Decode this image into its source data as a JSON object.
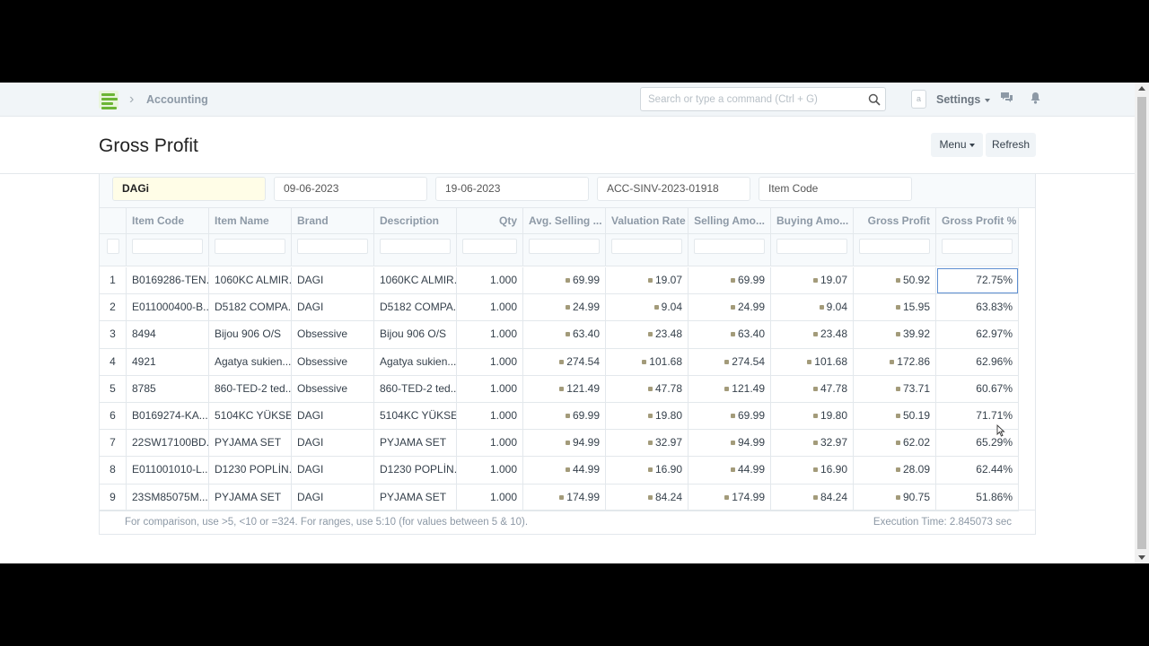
{
  "navbar": {
    "breadcrumb": "Accounting",
    "search_placeholder": "Search or type a command (Ctrl + G)",
    "avatar_letter": "a",
    "settings_label": "Settings"
  },
  "page": {
    "title": "Gross Profit",
    "menu_label": "Menu",
    "refresh_label": "Refresh"
  },
  "filters": [
    "DAGi",
    "09-06-2023",
    "19-06-2023",
    "ACC-SINV-2023-01918",
    "Item Code"
  ],
  "table": {
    "columns": [
      "Item Code",
      "Item Name",
      "Brand",
      "Description",
      "Qty",
      "Avg. Selling ...",
      "Valuation Rate",
      "Selling Amo...",
      "Buying Amo...",
      "Gross Profit",
      "Gross Profit %"
    ],
    "rows": [
      [
        "1",
        "B0169286-TEN...",
        "1060KC ALMIR...",
        "DAGI",
        "1060KC ALMIR...",
        "1.000",
        "69.99",
        "19.07",
        "69.99",
        "19.07",
        "50.92",
        "72.75%"
      ],
      [
        "2",
        "E011000400-B...",
        "D5182 COMPA...",
        "DAGI",
        "D5182 COMPA...",
        "1.000",
        "24.99",
        "9.04",
        "24.99",
        "9.04",
        "15.95",
        "63.83%"
      ],
      [
        "3",
        "8494",
        "Bijou 906 O/S",
        "Obsessive",
        "Bijou 906 O/S",
        "1.000",
        "63.40",
        "23.48",
        "63.40",
        "23.48",
        "39.92",
        "62.97%"
      ],
      [
        "4",
        "4921",
        "Agatya sukien...",
        "Obsessive",
        "Agatya sukien...",
        "1.000",
        "274.54",
        "101.68",
        "274.54",
        "101.68",
        "172.86",
        "62.96%"
      ],
      [
        "5",
        "8785",
        "860-TED-2 ted...",
        "Obsessive",
        "860-TED-2 ted...",
        "1.000",
        "121.49",
        "47.78",
        "121.49",
        "47.78",
        "73.71",
        "60.67%"
      ],
      [
        "6",
        "B0169274-KA...",
        "5104KC YÜKSE...",
        "DAGI",
        "5104KC YÜKSE...",
        "1.000",
        "69.99",
        "19.80",
        "69.99",
        "19.80",
        "50.19",
        "71.71%"
      ],
      [
        "7",
        "22SW17100BD...",
        "PYJAMA SET",
        "DAGI",
        "PYJAMA SET",
        "1.000",
        "94.99",
        "32.97",
        "94.99",
        "32.97",
        "62.02",
        "65.29%"
      ],
      [
        "8",
        "E011001010-L...",
        "D1230 POPLİN...",
        "DAGI",
        "D1230 POPLİN...",
        "1.000",
        "44.99",
        "16.90",
        "44.99",
        "16.90",
        "28.09",
        "62.44%"
      ],
      [
        "9",
        "23SM85075M...",
        "PYJAMA SET",
        "DAGI",
        "PYJAMA SET",
        "1.000",
        "174.99",
        "84.24",
        "174.99",
        "84.24",
        "90.75",
        "51.86%"
      ]
    ]
  },
  "footer": {
    "hint": "For comparison, use >5, <10 or =324. For ranges, use 5:10 (for values between 5 & 10).",
    "execution_time": "Execution Time: 2.845073 sec"
  },
  "colors": {
    "accent_green": "#6cb535",
    "selection_border": "#5e8fd1"
  }
}
